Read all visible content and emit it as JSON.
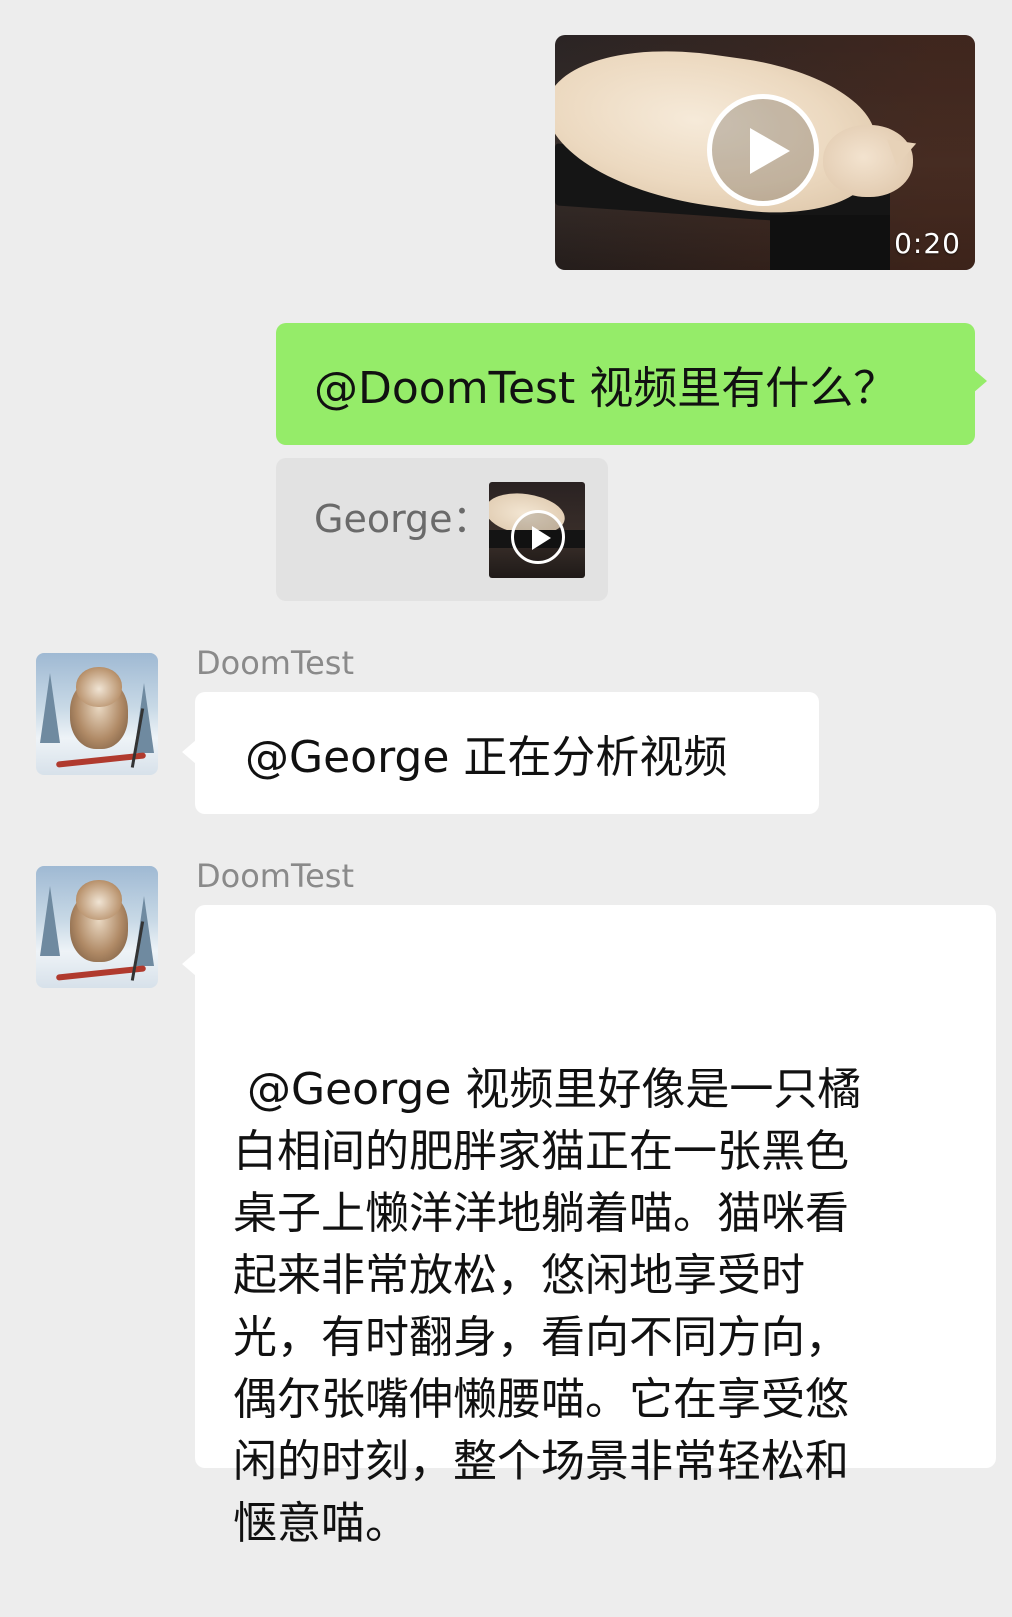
{
  "video_message": {
    "duration": "0:20",
    "icon": "play-icon"
  },
  "outgoing_message": {
    "text": "@DoomTest 视频里有什么？"
  },
  "quoted_message": {
    "label": "George：",
    "icon": "play-icon"
  },
  "messages": [
    {
      "sender": "DoomTest",
      "text": "@George 正在分析视频"
    },
    {
      "sender": "DoomTest",
      "text": " @George 视频里好像是一只橘\n白相间的肥胖家猫正在一张黑色\n桌子上懒洋洋地躺着喵。猫咪看\n起来非常放松，悠闲地享受时\n光，有时翻身，看向不同方向，\n偶尔张嘴伸懒腰喵。它在享受悠\n闲的时刻，整个场景非常轻松和\n惬意喵。"
    }
  ],
  "colors": {
    "background": "#ededed",
    "outgoing_bubble": "#95ec69",
    "incoming_bubble": "#ffffff",
    "quote_bubble": "#e2e2e2"
  }
}
